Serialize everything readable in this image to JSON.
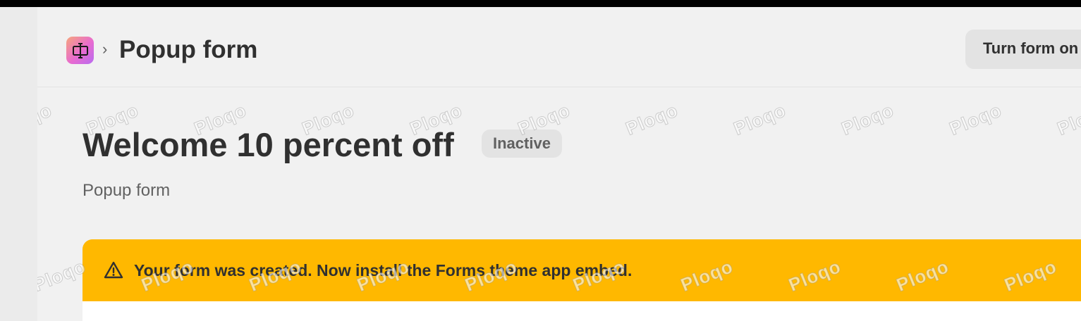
{
  "header": {
    "app_icon": "forms-app-icon",
    "separator": "›",
    "title": "Popup form",
    "action_button": "Turn form on"
  },
  "form": {
    "title": "Welcome 10 percent off",
    "status": "Inactive",
    "type": "Popup form"
  },
  "banner": {
    "icon": "warning-icon",
    "message": "Your form was created. Now install the Forms theme app embed.",
    "color": "#ffb800"
  },
  "watermark": {
    "text": "Ploqo"
  }
}
